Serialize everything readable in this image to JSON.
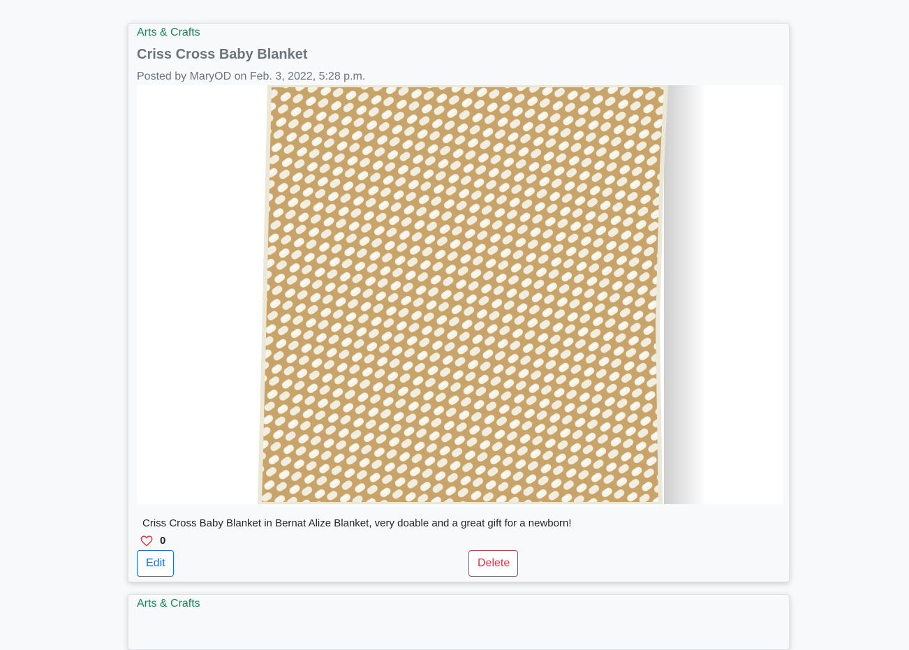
{
  "posts": [
    {
      "category": "Arts & Crafts",
      "title": "Criss Cross Baby Blanket",
      "meta": "Posted by MaryOD on Feb. 3, 2022, 5:28 p.m.",
      "description": "Criss Cross Baby Blanket in Bernat Alize Blanket, very doable and a great gift for a newborn!",
      "likes": "0",
      "edit_label": "Edit",
      "delete_label": "Delete",
      "image_alt": "white knitted criss-cross blanket"
    },
    {
      "category": "Arts & Crafts"
    }
  ],
  "colors": {
    "category": "#198754",
    "heart": "#dc3545",
    "edit": "#0d6efd",
    "delete": "#dc3545"
  },
  "icons": {
    "like": "heart-outline-icon"
  }
}
